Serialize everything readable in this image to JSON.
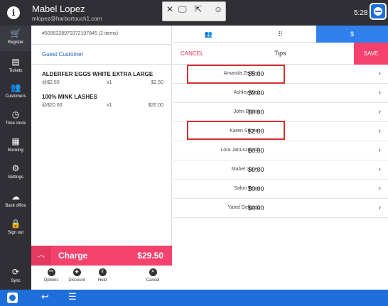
{
  "topbar": {
    "user_name": "Mabel Lopez",
    "user_email": "mlopez@harbortouch1.com",
    "time": "5:28",
    "remote_toolbar": {
      "close": "✕",
      "emoji": "☺"
    }
  },
  "nav": [
    {
      "label": "Register",
      "icon": "cart-icon",
      "glyph": "🛒"
    },
    {
      "label": "Tickets",
      "icon": "tickets-icon",
      "glyph": "▤"
    },
    {
      "label": "Customers",
      "icon": "customers-icon",
      "glyph": "👥"
    },
    {
      "label": "Time clock",
      "icon": "clock-icon",
      "glyph": "◷"
    },
    {
      "label": "Booking",
      "icon": "calendar-icon",
      "glyph": "▦"
    },
    {
      "label": "Settings",
      "icon": "gear-icon",
      "glyph": "⚙"
    },
    {
      "label": "Back office",
      "icon": "cloud-icon",
      "glyph": "☁"
    },
    {
      "label": "Sign out",
      "icon": "lock-icon",
      "glyph": "🔒"
    },
    {
      "label": "Sync",
      "icon": "sync-icon",
      "glyph": "⟳"
    }
  ],
  "ticket": {
    "id": "#50953289703721078​45 (2 items)",
    "customer": "Guest Customer",
    "items": [
      {
        "name": "ALDERFER EGGS WHITE EXTRA LARGE",
        "unit_price": "@$2.50",
        "qty": "x1",
        "total": "$2.50"
      },
      {
        "name": "100% MINK LASHES",
        "unit_price": "@$20.00",
        "qty": "x1",
        "total": "$20.00"
      }
    ],
    "charge_label": "Charge",
    "charge_amount": "$29.50",
    "actions": [
      {
        "label": "Options",
        "icon": "options-icon",
        "glyph": "•••"
      },
      {
        "label": "Discount",
        "icon": "tag-icon",
        "glyph": "◆"
      },
      {
        "label": "Hold",
        "icon": "pause-icon",
        "glyph": "II"
      },
      {
        "label": "Cancel",
        "icon": "cancel-icon",
        "glyph": "✕"
      }
    ]
  },
  "tabs": [
    {
      "label": "👥",
      "icon": "people-icon"
    },
    {
      "label": "⠿",
      "icon": "grid-icon"
    },
    {
      "label": "$",
      "icon": "dollar-icon"
    }
  ],
  "tips": {
    "cancel_label": "CANCEL",
    "title": "Tips",
    "save_label": "SAVE",
    "rows": [
      {
        "name": "Amanda Zerfoss",
        "amount": "$5.00",
        "highlighted": true
      },
      {
        "name": "Ashley Weir",
        "amount": "$0.00"
      },
      {
        "name": "John Emery",
        "amount": "$0.00"
      },
      {
        "name": "Karen Stinner",
        "amount": "$2.00",
        "highlighted": true
      },
      {
        "name": "Lora Januszewski",
        "amount": "$0.00"
      },
      {
        "name": "Mabel Lopez",
        "amount": "$0.00"
      },
      {
        "name": "Salon Team",
        "amount": "$0.00"
      },
      {
        "name": "Yariel Delgado",
        "amount": "$0.00"
      }
    ]
  },
  "colors": {
    "accent_blue": "#2f80ed",
    "charge_pink": "#f4426c",
    "nav_dark": "#2f2f35",
    "highlight_red": "#d32f2f"
  }
}
